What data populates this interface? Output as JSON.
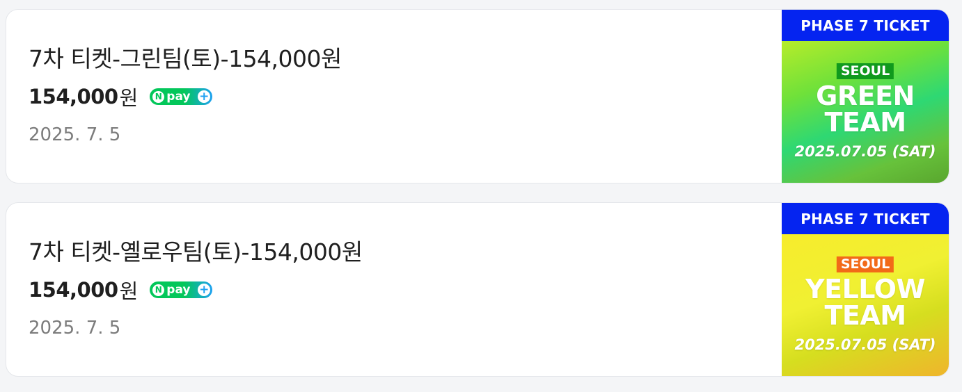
{
  "products": [
    {
      "title": "7차 티켓-그린팀(토)-154,000원",
      "price": "154,000",
      "price_unit": "원",
      "npay": {
        "n": "N",
        "label": "pay",
        "plus": "+"
      },
      "date": "2025. 7. 5",
      "thumbnail": {
        "theme": "green",
        "header": "PHASE 7 TICKET",
        "city": "SEOUL",
        "team_line1": "GREEN",
        "team_line2": "TEAM",
        "event_date": "2025.07.05 (SAT)",
        "accent": "#109a1d"
      }
    },
    {
      "title": "7차 티켓-옐로우팀(토)-154,000원",
      "price": "154,000",
      "price_unit": "원",
      "npay": {
        "n": "N",
        "label": "pay",
        "plus": "+"
      },
      "date": "2025. 7. 5",
      "thumbnail": {
        "theme": "yellow",
        "header": "PHASE 7 TICKET",
        "city": "SEOUL",
        "team_line1": "YELLOW",
        "team_line2": "TEAM",
        "event_date": "2025.07.05 (SAT)",
        "accent": "#f26a18"
      }
    }
  ],
  "colors": {
    "page_background": "#f4f5f7",
    "card_background": "#ffffff",
    "npay_green": "#03c75a",
    "npay_blue": "#1ea1f2",
    "ticket_band_blue": "#0524f0"
  }
}
